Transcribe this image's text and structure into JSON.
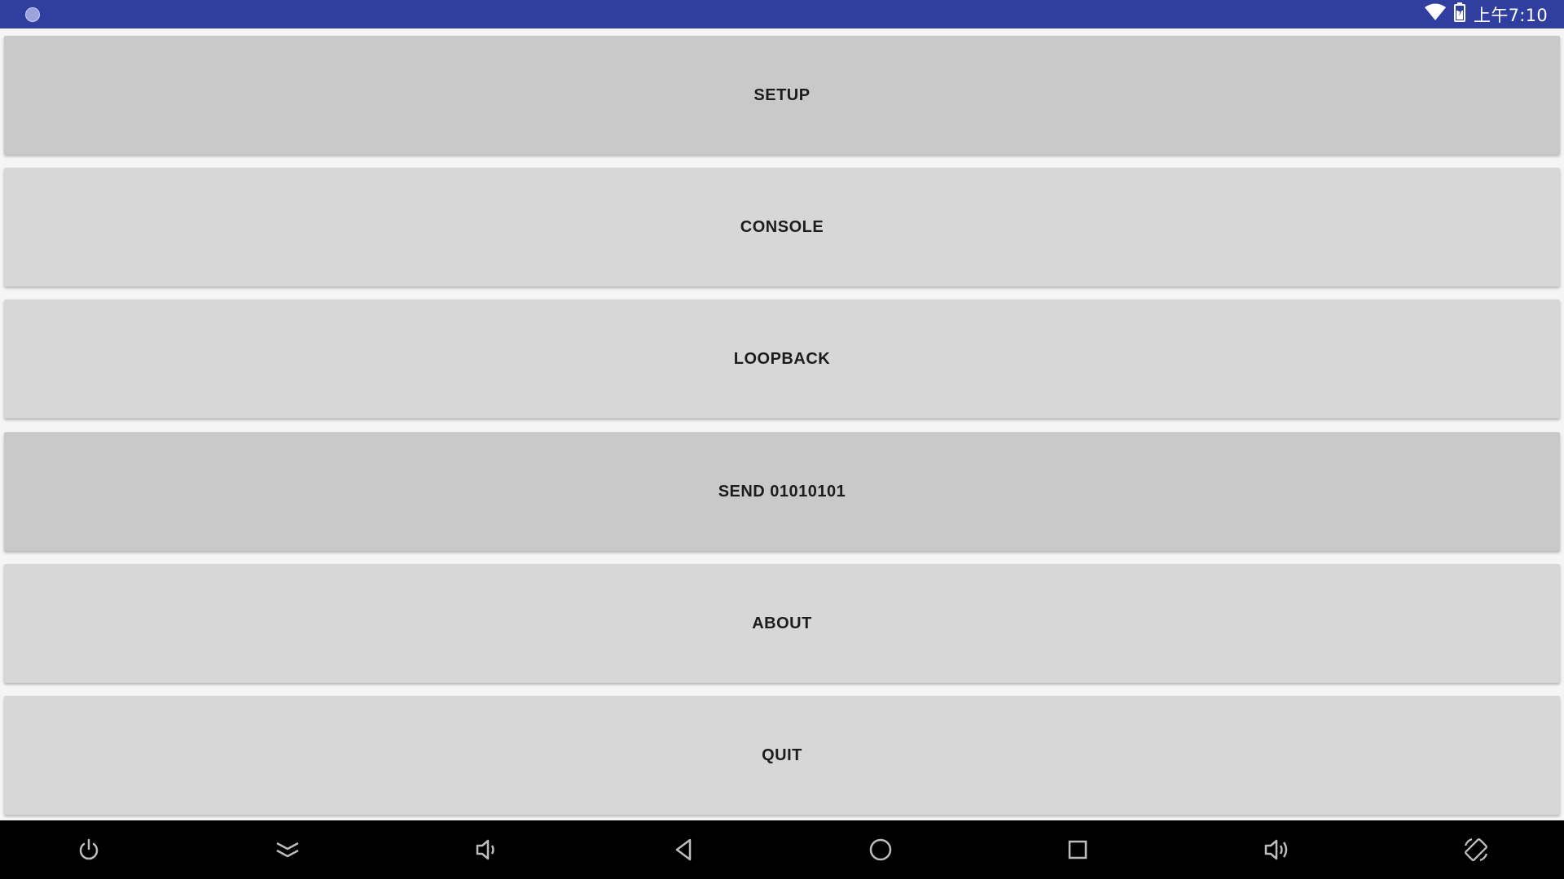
{
  "status_bar": {
    "time": "上午7:10",
    "icons": [
      "notification-dot-icon",
      "wifi-icon",
      "battery-icon"
    ],
    "background": "#303f9f"
  },
  "menu": {
    "buttons": [
      {
        "label": "SETUP",
        "pressed": true
      },
      {
        "label": "CONSOLE",
        "pressed": false
      },
      {
        "label": "LOOPBACK",
        "pressed": false
      },
      {
        "label": "SEND 01010101",
        "pressed": true
      },
      {
        "label": "ABOUT",
        "pressed": false
      },
      {
        "label": "QUIT",
        "pressed": false
      }
    ]
  },
  "nav_bar": {
    "icons": [
      "power-icon",
      "collapse-icon",
      "volume-down-icon",
      "back-icon",
      "home-icon",
      "recents-icon",
      "volume-up-icon",
      "rotate-icon"
    ]
  }
}
